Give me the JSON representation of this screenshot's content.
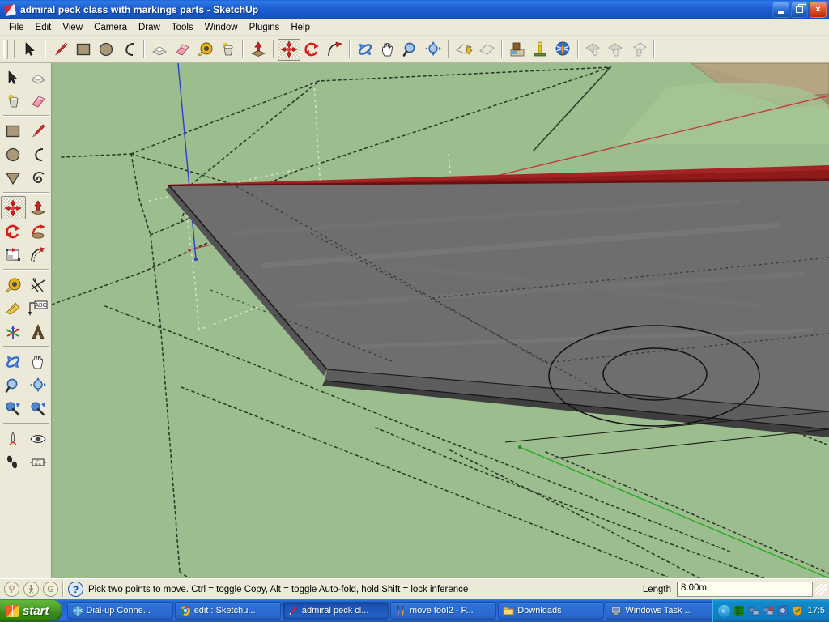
{
  "window": {
    "title": "admiral peck class with markings parts - SketchUp",
    "icon": "sketchup-pencil-icon",
    "controls": {
      "minimize": "_",
      "restore": "❐",
      "close": "×"
    }
  },
  "menubar": {
    "items": [
      {
        "label": "File"
      },
      {
        "label": "Edit"
      },
      {
        "label": "View"
      },
      {
        "label": "Camera"
      },
      {
        "label": "Draw"
      },
      {
        "label": "Tools"
      },
      {
        "label": "Window"
      },
      {
        "label": "Plugins"
      },
      {
        "label": "Help"
      }
    ]
  },
  "toolbar_top": {
    "groups": [
      {
        "tools": [
          {
            "name": "select-tool",
            "icon": "arrow-cursor-icon",
            "active": false
          }
        ]
      },
      {
        "tools": [
          {
            "name": "line-tool",
            "icon": "pencil-icon",
            "active": false
          },
          {
            "name": "rectangle-tool",
            "icon": "rectangle-icon",
            "active": false
          },
          {
            "name": "circle-tool",
            "icon": "circle-icon",
            "active": false
          },
          {
            "name": "arc-tool",
            "icon": "arc-icon",
            "active": false
          }
        ]
      },
      {
        "tools": [
          {
            "name": "make-component-tool",
            "icon": "component-box-icon",
            "active": false
          },
          {
            "name": "eraser-tool",
            "icon": "eraser-icon",
            "active": false
          },
          {
            "name": "tape-measure-tool",
            "icon": "tape-measure-icon",
            "active": false
          },
          {
            "name": "paint-bucket-tool",
            "icon": "paint-bucket-icon",
            "active": false
          }
        ]
      },
      {
        "tools": [
          {
            "name": "push-pull-tool",
            "icon": "push-pull-icon",
            "active": false
          }
        ]
      },
      {
        "tools": [
          {
            "name": "move-tool",
            "icon": "move-compass-icon",
            "active": true
          },
          {
            "name": "rotate-tool",
            "icon": "rotate-arrows-icon",
            "active": false
          },
          {
            "name": "follow-me-tool",
            "icon": "follow-me-icon",
            "active": false
          }
        ]
      },
      {
        "tools": [
          {
            "name": "orbit-tool",
            "icon": "orbit-icon",
            "active": false
          },
          {
            "name": "pan-tool",
            "icon": "hand-pan-icon",
            "active": false
          },
          {
            "name": "zoom-tool",
            "icon": "magnifier-icon",
            "active": false
          },
          {
            "name": "zoom-extents-tool",
            "icon": "zoom-extents-icon",
            "active": false
          }
        ]
      },
      {
        "tools": [
          {
            "name": "previous-view-button",
            "icon": "previous-view-icon",
            "active": false
          },
          {
            "name": "next-view-button",
            "icon": "next-view-icon",
            "active": false
          }
        ]
      },
      {
        "tools": [
          {
            "name": "get-models-button",
            "icon": "warehouse-models-icon",
            "active": false
          },
          {
            "name": "share-model-button",
            "icon": "share-model-icon",
            "active": false
          },
          {
            "name": "earth-button",
            "icon": "globe-icon",
            "active": false
          }
        ]
      },
      {
        "tools": [
          {
            "name": "layers-download-button",
            "icon": "layers-down-icon",
            "active": false
          },
          {
            "name": "layers-upload-button",
            "icon": "layers-up-icon",
            "active": false
          },
          {
            "name": "layers-place-button",
            "icon": "layers-place-icon",
            "active": false
          }
        ]
      }
    ]
  },
  "toolbar_left": {
    "groups": [
      {
        "rows": [
          [
            {
              "name": "select-tool",
              "icon": "arrow-cursor-icon",
              "active": false
            },
            {
              "name": "make-component-tool",
              "icon": "component-box-icon",
              "active": false
            }
          ],
          [
            {
              "name": "paint-bucket-tool",
              "icon": "paint-bucket-icon",
              "active": false
            },
            {
              "name": "eraser-tool",
              "icon": "eraser-icon",
              "active": false
            }
          ]
        ]
      },
      {
        "rows": [
          [
            {
              "name": "rectangle-tool",
              "icon": "rectangle-icon",
              "active": false
            },
            {
              "name": "line-tool",
              "icon": "pencil-icon",
              "active": false
            }
          ],
          [
            {
              "name": "circle-tool",
              "icon": "circle-icon",
              "active": false
            },
            {
              "name": "arc-tool",
              "icon": "arc-icon",
              "active": false
            }
          ],
          [
            {
              "name": "polygon-tool",
              "icon": "polygon-icon",
              "active": false
            },
            {
              "name": "freehand-tool",
              "icon": "freehand-icon",
              "active": false
            }
          ]
        ]
      },
      {
        "rows": [
          [
            {
              "name": "move-tool",
              "icon": "move-compass-icon",
              "active": true
            },
            {
              "name": "push-pull-tool",
              "icon": "push-pull-icon",
              "active": false
            }
          ],
          [
            {
              "name": "rotate-tool",
              "icon": "rotate-arrows-icon",
              "active": false
            },
            {
              "name": "follow-me-tool",
              "icon": "follow-me-icon",
              "active": false
            }
          ],
          [
            {
              "name": "scale-tool",
              "icon": "scale-icon",
              "active": false
            },
            {
              "name": "offset-tool",
              "icon": "offset-icon",
              "active": false
            }
          ]
        ]
      },
      {
        "rows": [
          [
            {
              "name": "tape-measure-tool",
              "icon": "tape-measure-icon",
              "active": false
            },
            {
              "name": "dimension-tool",
              "icon": "dimension-icon",
              "active": false
            }
          ],
          [
            {
              "name": "protractor-tool",
              "icon": "protractor-icon",
              "active": false
            },
            {
              "name": "text-tool",
              "icon": "abc-text-icon",
              "active": false
            }
          ],
          [
            {
              "name": "axes-tool",
              "icon": "axes-icon",
              "active": false
            },
            {
              "name": "3d-text-tool",
              "icon": "3d-text-icon",
              "active": false
            }
          ]
        ]
      },
      {
        "rows": [
          [
            {
              "name": "orbit-tool",
              "icon": "orbit-icon",
              "active": false
            },
            {
              "name": "pan-tool",
              "icon": "hand-pan-icon",
              "active": false
            }
          ],
          [
            {
              "name": "zoom-tool",
              "icon": "magnifier-icon",
              "active": false
            },
            {
              "name": "zoom-extents-tool",
              "icon": "zoom-extents-icon",
              "active": false
            }
          ],
          [
            {
              "name": "previous-view-button",
              "icon": "previous-view-icon",
              "active": false
            },
            {
              "name": "next-view-button",
              "icon": "next-view-icon",
              "active": false
            }
          ]
        ]
      },
      {
        "rows": [
          [
            {
              "name": "position-camera-tool",
              "icon": "position-camera-icon",
              "active": false
            },
            {
              "name": "look-around-tool",
              "icon": "eye-icon",
              "active": false
            }
          ],
          [
            {
              "name": "walk-tool",
              "icon": "footsteps-icon",
              "active": false
            },
            {
              "name": "section-plane-tool",
              "icon": "section-plane-icon",
              "active": false
            }
          ]
        ]
      }
    ]
  },
  "viewport": {
    "name": "3d-modeling-viewport",
    "background_color": "#9cbd8e",
    "model_description": "warship deck 3d model with turret ring markings",
    "colors": {
      "deck_top": "#6e6e6e",
      "deck_shade": "#5a5a5a",
      "deck_edge_dark": "#3e3e3e",
      "red_strip": "#7d1414",
      "red_strip_light": "#a32020",
      "tan_wedge": "#b5a681",
      "axis_red": "#c23b3b",
      "axis_green": "#23a823",
      "axis_blue": "#2b3fd0",
      "guide_dot": "#2e3a2a",
      "ghost_fill": "#b4cfa6"
    }
  },
  "statusbar": {
    "indicators": [
      {
        "name": "geo-location-indicator",
        "icon": "pin-circle-icon",
        "glyph": "⚲"
      },
      {
        "name": "shadow-indicator",
        "icon": "person-circle-icon",
        "glyph": "ᵜ"
      },
      {
        "name": "credits-indicator",
        "icon": "g-circle-icon",
        "glyph": "G"
      }
    ],
    "help_icon": "question-mark-icon",
    "help_glyph": "?",
    "message": "Pick two points to move.  Ctrl = toggle Copy, Alt = toggle Auto-fold, hold Shift = lock inference",
    "measurement_label": "Length",
    "measurement_value": "8.00m"
  },
  "taskbar": {
    "start_label": "start",
    "start_icon": "windows-flag-icon",
    "tasks": [
      {
        "name": "taskbar-item-dialup",
        "label": "Dial-up Conne...",
        "icon": "network-globe-icon",
        "icon_color": "#4a9fd8",
        "active": false
      },
      {
        "name": "taskbar-item-chrome",
        "label": "edit : Sketchu...",
        "icon": "chrome-icon",
        "icon_color": "#e8b21c",
        "active": false
      },
      {
        "name": "taskbar-item-sketchup",
        "label": "admiral peck cl...",
        "icon": "sketchup-pencil-icon",
        "icon_color": "#d9263a",
        "active": true
      },
      {
        "name": "taskbar-item-movetool",
        "label": "move tool2 - P...",
        "icon": "paint-brushes-icon",
        "icon_color": "#9a7ab5",
        "active": false
      },
      {
        "name": "taskbar-item-downloads",
        "label": "Downloads",
        "icon": "folder-icon",
        "icon_color": "#f5c252",
        "active": false
      },
      {
        "name": "taskbar-item-taskmanager",
        "label": "Windows Task ...",
        "icon": "task-manager-icon",
        "icon_color": "#cfd4da",
        "active": false
      }
    ],
    "tray": {
      "chevron_glyph": "«",
      "icons": [
        {
          "name": "tray-icon-green-grid",
          "color": "#1f8a1f"
        },
        {
          "name": "tray-icon-network",
          "color": "#6d8fc4"
        },
        {
          "name": "tray-icon-network-disconnected",
          "color": "#c23b3b"
        },
        {
          "name": "tray-icon-blue-disc",
          "color": "#3d74bd"
        },
        {
          "name": "tray-icon-shield-check",
          "color": "#e8a02a"
        }
      ],
      "clock": "17:5"
    }
  }
}
